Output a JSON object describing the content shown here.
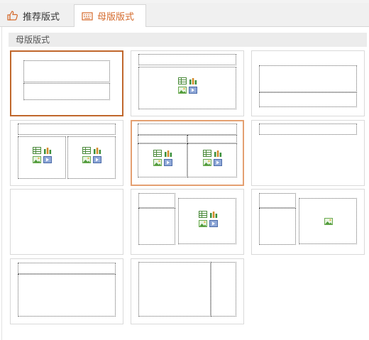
{
  "tabs": [
    {
      "label": "推荐版式",
      "icon": "thumbs-up-icon",
      "active": false
    },
    {
      "label": "母版版式",
      "icon": "layout-keyboard-icon",
      "active": true
    }
  ],
  "section_title": "母版版式",
  "accent_color": "#c0672c",
  "layouts": [
    {
      "name": "title-slide",
      "selected": "strong"
    },
    {
      "name": "title-and-content",
      "selected": "none"
    },
    {
      "name": "section-header",
      "selected": "none"
    },
    {
      "name": "two-content",
      "selected": "none"
    },
    {
      "name": "comparison",
      "selected": "light"
    },
    {
      "name": "title-only",
      "selected": "none"
    },
    {
      "name": "blank",
      "selected": "none"
    },
    {
      "name": "content-with-caption",
      "selected": "none"
    },
    {
      "name": "picture-with-caption",
      "selected": "none"
    },
    {
      "name": "title-and-vertical-text",
      "selected": "none"
    },
    {
      "name": "vertical-title-and-text",
      "selected": "none"
    }
  ]
}
